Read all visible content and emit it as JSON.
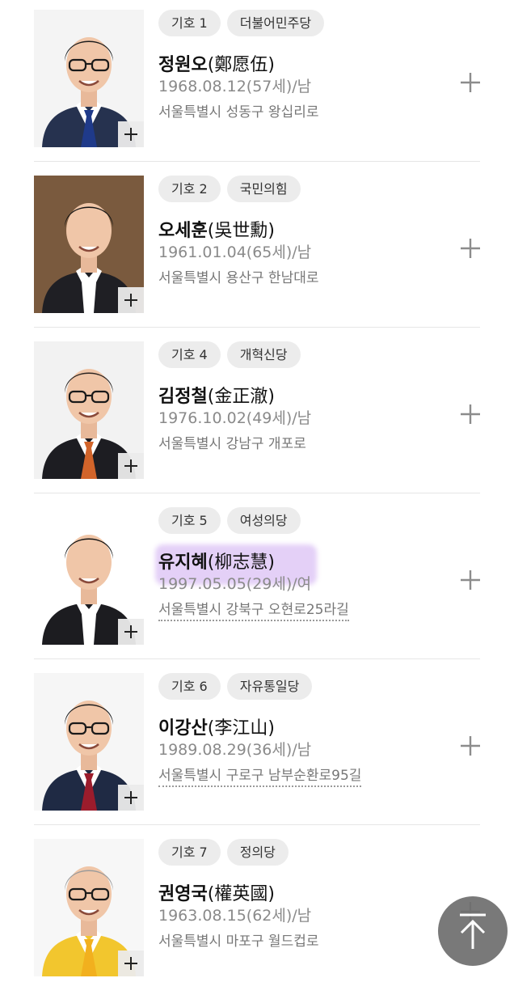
{
  "candidates": [
    {
      "number_tag": "기호 1",
      "party": "더불어민주당",
      "name_ko": "정원오",
      "name_hanja": "(鄭愿伍)",
      "birth": "1968.08.12(57세)/남",
      "address": "서울특별시 성동구 왕십리로",
      "tie_color": "#1f3a8a",
      "suit_color": "#26324f",
      "shirt_color": "#ffffff",
      "has_glasses": true,
      "hair_color": "#1c1c1c",
      "bg_color": "#f4f4f4"
    },
    {
      "number_tag": "기호 2",
      "party": "국민의힘",
      "name_ko": "오세훈",
      "name_hanja": "(吳世勳)",
      "birth": "1961.01.04(65세)/남",
      "address": "서울특별시 용산구 한남대로",
      "tie_color": "#ffffff",
      "suit_color": "#1f1f24",
      "shirt_color": "#ffffff",
      "has_glasses": false,
      "hair_color": "#141414",
      "bg_color": "#7a5a3e"
    },
    {
      "number_tag": "기호 4",
      "party": "개혁신당",
      "name_ko": "김정철",
      "name_hanja": "(金正澈)",
      "birth": "1976.10.02(49세)/남",
      "address": "서울특별시 강남구 개포로",
      "tie_color": "#d2642a",
      "suit_color": "#1d1d22",
      "shirt_color": "#ffffff",
      "has_glasses": true,
      "hair_color": "#2a2320",
      "bg_color": "#f2f2f2"
    },
    {
      "number_tag": "기호 5",
      "party": "여성의당",
      "name_ko": "유지혜",
      "name_hanja": "(柳志慧)",
      "birth": "1997.05.05(29세)/여",
      "address": "서울특별시 강북구 오현로25라길",
      "tie_color": "#ffffff",
      "suit_color": "#1c1c20",
      "shirt_color": "#ffffff",
      "has_glasses": false,
      "hair_color": "#111111",
      "bg_color": "#ffffff"
    },
    {
      "number_tag": "기호 6",
      "party": "자유통일당",
      "name_ko": "이강산",
      "name_hanja": "(李江山)",
      "birth": "1989.08.29(36세)/남",
      "address": "서울특별시 구로구 남부순환로95길",
      "tie_color": "#9b1c2c",
      "suit_color": "#1f2a44",
      "shirt_color": "#ffffff",
      "has_glasses": true,
      "hair_color": "#1b1b1b",
      "bg_color": "#f6f6f6"
    },
    {
      "number_tag": "기호 7",
      "party": "정의당",
      "name_ko": "권영국",
      "name_hanja": "(權英國)",
      "birth": "1963.08.15(62세)/남",
      "address": "서울특별시 마포구 월드컵로",
      "tie_color": "#f2b01e",
      "suit_color": "#f2c62e",
      "shirt_color": "#ffffff",
      "has_glasses": true,
      "hair_color": "#9a9a9a",
      "bg_color": "#f7f7f7"
    }
  ],
  "icons": {
    "photo_add": "plus-icon",
    "row_add": "plus-icon",
    "scroll_top": "arrow-up-to-top-icon"
  },
  "colors": {
    "tag_bg": "#ececec",
    "highlight": "#cdaaf0",
    "top_button": "#6e6e6e"
  }
}
